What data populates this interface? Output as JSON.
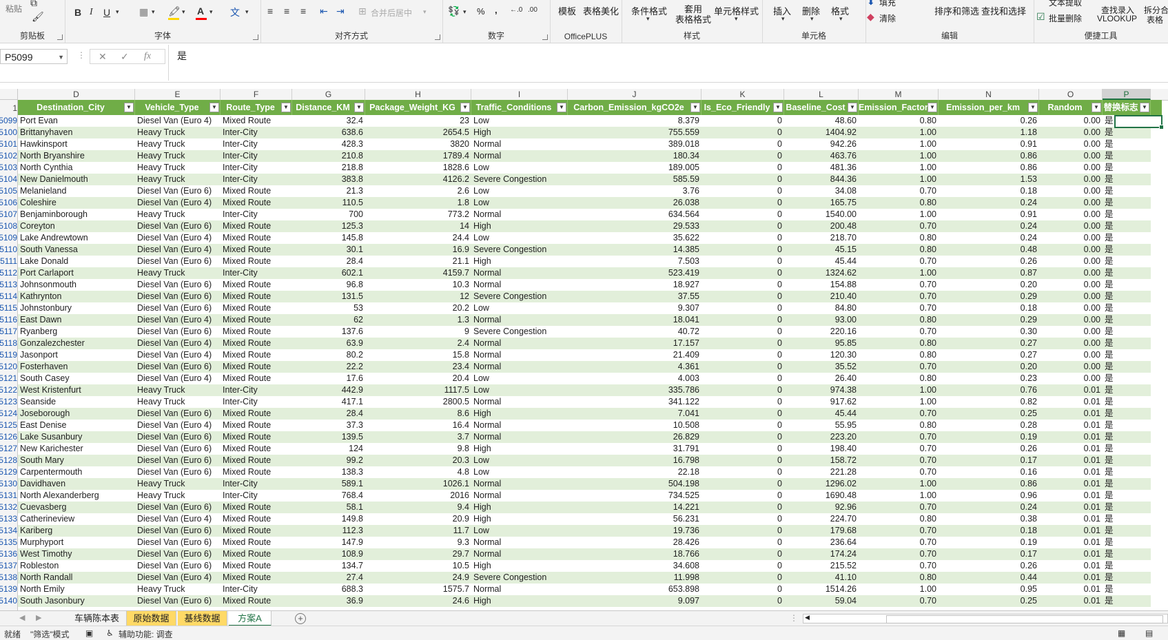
{
  "ribbon": {
    "groups": [
      "剪贴板",
      "字体",
      "对齐方式",
      "数字",
      "OfficePLUS",
      "样式",
      "单元格",
      "编辑",
      "便捷工具"
    ],
    "paste_label": "粘贴",
    "merge_label": "合并后居中",
    "percent_label": "%",
    "comma_label": ",",
    "template_label": "模板",
    "beautify_label": "表格美化",
    "cond_format_label": "条件格式",
    "apply_table_label": "套用\n表格格式",
    "cell_style_label": "单元格样式",
    "insert_label": "插入",
    "delete_label": "删除",
    "format_label": "格式",
    "fill_label": "填充",
    "clear_label": "清除",
    "sort_filter_label": "排序和筛选",
    "find_select_label": "查找和选择",
    "text_extract_label": "文本提取",
    "batch_delete_label": "批量删除",
    "lookup_label": "查找录入",
    "vlookup_label": "VLOOKUP",
    "split_label": "拆分合",
    "table_label": "表格",
    "font_color": "#ff0000",
    "fill_color": "#ffd700"
  },
  "formula_bar": {
    "name_box": "P5099",
    "formula": "是"
  },
  "column_letters": [
    "D",
    "E",
    "F",
    "G",
    "H",
    "I",
    "J",
    "K",
    "L",
    "M",
    "N",
    "O",
    "P"
  ],
  "header_row_number": "1",
  "headers": [
    "Destination_City",
    "Vehicle_Type",
    "Route_Type",
    "Distance_KM",
    "Package_Weight_KG",
    "Traffic_Conditions",
    "Carbon_Emission_kgCO2e",
    "Is_Eco_Friendly",
    "Baseline_Cost",
    "Emission_Factor",
    "Emission_per_km",
    "Random",
    "替换标志"
  ],
  "rows": [
    [
      "5099",
      "Port Evan",
      "Diesel Van (Euro 4)",
      "Mixed Route",
      "32.4",
      "23",
      "Low",
      "8.379",
      "0",
      "48.60",
      "0.80",
      "0.26",
      "0.00",
      "是"
    ],
    [
      "5100",
      "Brittanyhaven",
      "Heavy Truck",
      "Inter-City",
      "638.6",
      "2654.5",
      "High",
      "755.559",
      "0",
      "1404.92",
      "1.00",
      "1.18",
      "0.00",
      "是"
    ],
    [
      "5101",
      "Hawkinsport",
      "Heavy Truck",
      "Inter-City",
      "428.3",
      "3820",
      "Normal",
      "389.018",
      "0",
      "942.26",
      "1.00",
      "0.91",
      "0.00",
      "是"
    ],
    [
      "5102",
      "North Bryanshire",
      "Heavy Truck",
      "Inter-City",
      "210.8",
      "1789.4",
      "Normal",
      "180.34",
      "0",
      "463.76",
      "1.00",
      "0.86",
      "0.00",
      "是"
    ],
    [
      "5103",
      "North Cynthia",
      "Heavy Truck",
      "Inter-City",
      "218.8",
      "1828.6",
      "Low",
      "189.005",
      "0",
      "481.36",
      "1.00",
      "0.86",
      "0.00",
      "是"
    ],
    [
      "5104",
      "New Danielmouth",
      "Heavy Truck",
      "Inter-City",
      "383.8",
      "4126.2",
      "Severe Congestion",
      "585.59",
      "0",
      "844.36",
      "1.00",
      "1.53",
      "0.00",
      "是"
    ],
    [
      "5105",
      "Melanieland",
      "Diesel Van (Euro 6)",
      "Mixed Route",
      "21.3",
      "2.6",
      "Low",
      "3.76",
      "0",
      "34.08",
      "0.70",
      "0.18",
      "0.00",
      "是"
    ],
    [
      "5106",
      "Coleshire",
      "Diesel Van (Euro 4)",
      "Mixed Route",
      "110.5",
      "1.8",
      "Low",
      "26.038",
      "0",
      "165.75",
      "0.80",
      "0.24",
      "0.00",
      "是"
    ],
    [
      "5107",
      "Benjaminborough",
      "Heavy Truck",
      "Inter-City",
      "700",
      "773.2",
      "Normal",
      "634.564",
      "0",
      "1540.00",
      "1.00",
      "0.91",
      "0.00",
      "是"
    ],
    [
      "5108",
      "Coreyton",
      "Diesel Van (Euro 6)",
      "Mixed Route",
      "125.3",
      "14",
      "High",
      "29.533",
      "0",
      "200.48",
      "0.70",
      "0.24",
      "0.00",
      "是"
    ],
    [
      "5109",
      "Lake Andrewtown",
      "Diesel Van (Euro 4)",
      "Mixed Route",
      "145.8",
      "24.4",
      "Low",
      "35.622",
      "0",
      "218.70",
      "0.80",
      "0.24",
      "0.00",
      "是"
    ],
    [
      "5110",
      "South Vanessa",
      "Diesel Van (Euro 4)",
      "Mixed Route",
      "30.1",
      "16.9",
      "Severe Congestion",
      "14.385",
      "0",
      "45.15",
      "0.80",
      "0.48",
      "0.00",
      "是"
    ],
    [
      "5111",
      "Lake Donald",
      "Diesel Van (Euro 6)",
      "Mixed Route",
      "28.4",
      "21.1",
      "High",
      "7.503",
      "0",
      "45.44",
      "0.70",
      "0.26",
      "0.00",
      "是"
    ],
    [
      "5112",
      "Port Carlaport",
      "Heavy Truck",
      "Inter-City",
      "602.1",
      "4159.7",
      "Normal",
      "523.419",
      "0",
      "1324.62",
      "1.00",
      "0.87",
      "0.00",
      "是"
    ],
    [
      "5113",
      "Johnsonmouth",
      "Diesel Van (Euro 6)",
      "Mixed Route",
      "96.8",
      "10.3",
      "Normal",
      "18.927",
      "0",
      "154.88",
      "0.70",
      "0.20",
      "0.00",
      "是"
    ],
    [
      "5114",
      "Kathrynton",
      "Diesel Van (Euro 6)",
      "Mixed Route",
      "131.5",
      "12",
      "Severe Congestion",
      "37.55",
      "0",
      "210.40",
      "0.70",
      "0.29",
      "0.00",
      "是"
    ],
    [
      "5115",
      "Johnstonbury",
      "Diesel Van (Euro 6)",
      "Mixed Route",
      "53",
      "20.2",
      "Low",
      "9.307",
      "0",
      "84.80",
      "0.70",
      "0.18",
      "0.00",
      "是"
    ],
    [
      "5116",
      "East Dawn",
      "Diesel Van (Euro 4)",
      "Mixed Route",
      "62",
      "1.3",
      "Normal",
      "18.041",
      "0",
      "93.00",
      "0.80",
      "0.29",
      "0.00",
      "是"
    ],
    [
      "5117",
      "Ryanberg",
      "Diesel Van (Euro 6)",
      "Mixed Route",
      "137.6",
      "9",
      "Severe Congestion",
      "40.72",
      "0",
      "220.16",
      "0.70",
      "0.30",
      "0.00",
      "是"
    ],
    [
      "5118",
      "Gonzalezchester",
      "Diesel Van (Euro 4)",
      "Mixed Route",
      "63.9",
      "2.4",
      "Normal",
      "17.157",
      "0",
      "95.85",
      "0.80",
      "0.27",
      "0.00",
      "是"
    ],
    [
      "5119",
      "Jasonport",
      "Diesel Van (Euro 4)",
      "Mixed Route",
      "80.2",
      "15.8",
      "Normal",
      "21.409",
      "0",
      "120.30",
      "0.80",
      "0.27",
      "0.00",
      "是"
    ],
    [
      "5120",
      "Fosterhaven",
      "Diesel Van (Euro 6)",
      "Mixed Route",
      "22.2",
      "23.4",
      "Normal",
      "4.361",
      "0",
      "35.52",
      "0.70",
      "0.20",
      "0.00",
      "是"
    ],
    [
      "5121",
      "South Casey",
      "Diesel Van (Euro 4)",
      "Mixed Route",
      "17.6",
      "20.4",
      "Low",
      "4.003",
      "0",
      "26.40",
      "0.80",
      "0.23",
      "0.00",
      "是"
    ],
    [
      "5122",
      "West Kristenfurt",
      "Heavy Truck",
      "Inter-City",
      "442.9",
      "1117.5",
      "Low",
      "335.786",
      "0",
      "974.38",
      "1.00",
      "0.76",
      "0.01",
      "是"
    ],
    [
      "5123",
      "Seanside",
      "Heavy Truck",
      "Inter-City",
      "417.1",
      "2800.5",
      "Normal",
      "341.122",
      "0",
      "917.62",
      "1.00",
      "0.82",
      "0.01",
      "是"
    ],
    [
      "5124",
      "Joseborough",
      "Diesel Van (Euro 6)",
      "Mixed Route",
      "28.4",
      "8.6",
      "High",
      "7.041",
      "0",
      "45.44",
      "0.70",
      "0.25",
      "0.01",
      "是"
    ],
    [
      "5125",
      "East Denise",
      "Diesel Van (Euro 4)",
      "Mixed Route",
      "37.3",
      "16.4",
      "Normal",
      "10.508",
      "0",
      "55.95",
      "0.80",
      "0.28",
      "0.01",
      "是"
    ],
    [
      "5126",
      "Lake Susanbury",
      "Diesel Van (Euro 6)",
      "Mixed Route",
      "139.5",
      "3.7",
      "Normal",
      "26.829",
      "0",
      "223.20",
      "0.70",
      "0.19",
      "0.01",
      "是"
    ],
    [
      "5127",
      "New Karichester",
      "Diesel Van (Euro 6)",
      "Mixed Route",
      "124",
      "9.8",
      "High",
      "31.791",
      "0",
      "198.40",
      "0.70",
      "0.26",
      "0.01",
      "是"
    ],
    [
      "5128",
      "South Mary",
      "Diesel Van (Euro 6)",
      "Mixed Route",
      "99.2",
      "20.3",
      "Low",
      "16.798",
      "0",
      "158.72",
      "0.70",
      "0.17",
      "0.01",
      "是"
    ],
    [
      "5129",
      "Carpentermouth",
      "Diesel Van (Euro 6)",
      "Mixed Route",
      "138.3",
      "4.8",
      "Low",
      "22.18",
      "0",
      "221.28",
      "0.70",
      "0.16",
      "0.01",
      "是"
    ],
    [
      "5130",
      "Davidhaven",
      "Heavy Truck",
      "Inter-City",
      "589.1",
      "1026.1",
      "Normal",
      "504.198",
      "0",
      "1296.02",
      "1.00",
      "0.86",
      "0.01",
      "是"
    ],
    [
      "5131",
      "North Alexanderberg",
      "Heavy Truck",
      "Inter-City",
      "768.4",
      "2016",
      "Normal",
      "734.525",
      "0",
      "1690.48",
      "1.00",
      "0.96",
      "0.01",
      "是"
    ],
    [
      "5132",
      "Cuevasberg",
      "Diesel Van (Euro 6)",
      "Mixed Route",
      "58.1",
      "9.4",
      "High",
      "14.221",
      "0",
      "92.96",
      "0.70",
      "0.24",
      "0.01",
      "是"
    ],
    [
      "5133",
      "Catherineview",
      "Diesel Van (Euro 4)",
      "Mixed Route",
      "149.8",
      "20.9",
      "High",
      "56.231",
      "0",
      "224.70",
      "0.80",
      "0.38",
      "0.01",
      "是"
    ],
    [
      "5134",
      "Kariberg",
      "Diesel Van (Euro 6)",
      "Mixed Route",
      "112.3",
      "11.7",
      "Low",
      "19.736",
      "0",
      "179.68",
      "0.70",
      "0.18",
      "0.01",
      "是"
    ],
    [
      "5135",
      "Murphyport",
      "Diesel Van (Euro 6)",
      "Mixed Route",
      "147.9",
      "9.3",
      "Normal",
      "28.426",
      "0",
      "236.64",
      "0.70",
      "0.19",
      "0.01",
      "是"
    ],
    [
      "5136",
      "West Timothy",
      "Diesel Van (Euro 6)",
      "Mixed Route",
      "108.9",
      "29.7",
      "Normal",
      "18.766",
      "0",
      "174.24",
      "0.70",
      "0.17",
      "0.01",
      "是"
    ],
    [
      "5137",
      "Robleston",
      "Diesel Van (Euro 6)",
      "Mixed Route",
      "134.7",
      "10.5",
      "High",
      "34.608",
      "0",
      "215.52",
      "0.70",
      "0.26",
      "0.01",
      "是"
    ],
    [
      "5138",
      "North Randall",
      "Diesel Van (Euro 4)",
      "Mixed Route",
      "27.4",
      "24.9",
      "Severe Congestion",
      "11.998",
      "0",
      "41.10",
      "0.80",
      "0.44",
      "0.01",
      "是"
    ],
    [
      "5139",
      "North Emily",
      "Heavy Truck",
      "Inter-City",
      "688.3",
      "1575.7",
      "Normal",
      "653.898",
      "0",
      "1514.26",
      "1.00",
      "0.95",
      "0.01",
      "是"
    ],
    [
      "5140",
      "South Jasonbury",
      "Diesel Van (Euro 6)",
      "Mixed Route",
      "36.9",
      "24.6",
      "High",
      "9.097",
      "0",
      "59.04",
      "0.70",
      "0.25",
      "0.01",
      "是"
    ]
  ],
  "sheet_tabs": [
    {
      "label": "车辆陈本表",
      "style": "normal"
    },
    {
      "label": "原始数据",
      "style": "yellow"
    },
    {
      "label": "基线数据",
      "style": "yellow"
    },
    {
      "label": "方案A",
      "style": "active"
    }
  ],
  "status": {
    "ready": "就绪",
    "filter_mode": "\"筛选\"模式",
    "accessibility": "辅助功能: 调查"
  },
  "colors": {
    "header_green": "#70ad47",
    "band_green": "#e2efda",
    "accent": "#217346"
  }
}
